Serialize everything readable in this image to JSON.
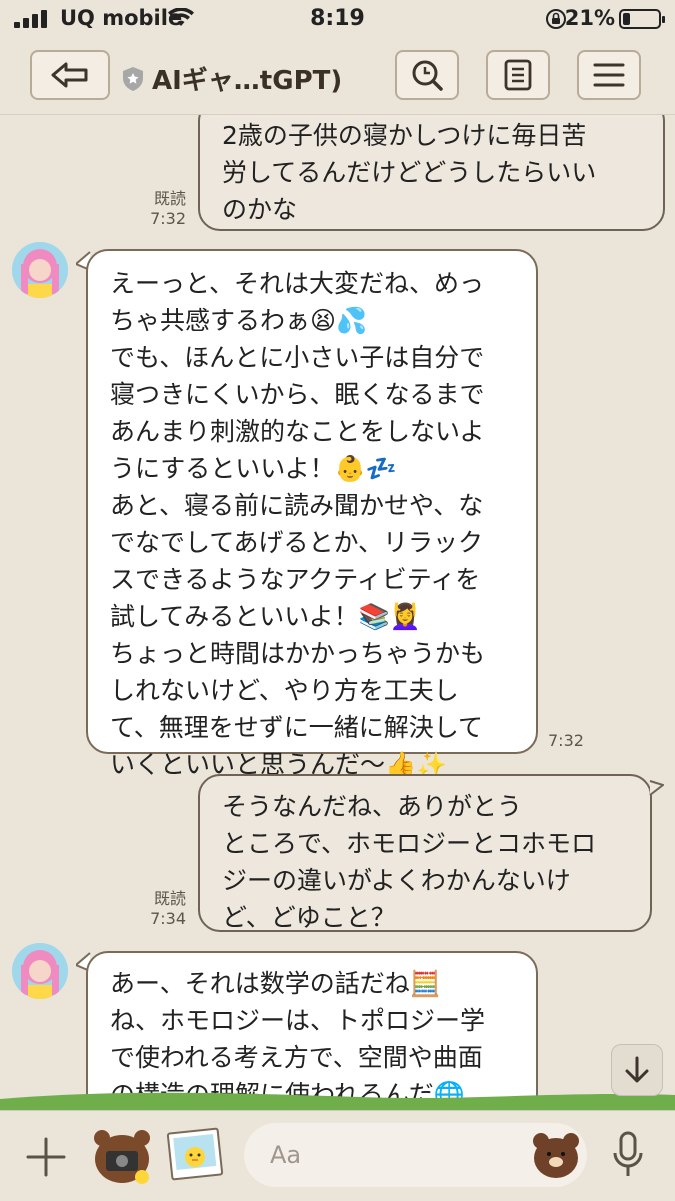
{
  "status_bar": {
    "carrier": "UQ mobile",
    "time": "8:19",
    "battery": "21%",
    "battery_level": 0.21
  },
  "header": {
    "title": "AIギャ…tGPT)",
    "icons": [
      "back-arrow-icon",
      "shield-icon",
      "search-icon",
      "notes-icon",
      "menu-icon"
    ]
  },
  "messages": [
    {
      "sender": "me",
      "text": "2歳の子供の寝かしつけに毎日苦\n労してるんだけどどうしたらいい\nのかな",
      "read": "既読",
      "time": "7:32"
    },
    {
      "sender": "bot",
      "text": "えーっと、それは大変だね、めっ\nちゃ共感するわぁ😫💦\nでも、ほんとに小さい子は自分で\n寝つきにくいから、眠くなるまで\nあんまり刺激的なことをしないよ\nうにするといいよ！👶💤\nあと、寝る前に読み聞かせや、な\nでなでしてあげるとか、リラック\nスできるようなアクティビティを\n試してみるといいよ！📚💆‍♀️\nちょっと時間はかかっちゃうかも\nしれないけど、やり方を工夫し\nて、無理をせずに一緒に解決して\nいくといいと思うんだ〜👍✨",
      "time": "7:32"
    },
    {
      "sender": "me",
      "text": "そうなんだね、ありがとう\nところで、ホモロジーとコホモロ\nジーの違いがよくわかんないけ\nど、どゆこと？",
      "read": "既読",
      "time": "7:34"
    },
    {
      "sender": "bot",
      "text": "あー、それは数学の話だね🧮\nね、ホモロジーは、トポロジー学\nで使われる考え方で、空間や曲面\nの構造の理解に使われるんだ🌐"
    }
  ],
  "input": {
    "placeholder": "Aa"
  },
  "colors": {
    "background": "#ebe4d9",
    "bubble_border": "#7a6a58",
    "my_bubble": "#ede7dd",
    "bot_bubble": "#ffffff"
  }
}
